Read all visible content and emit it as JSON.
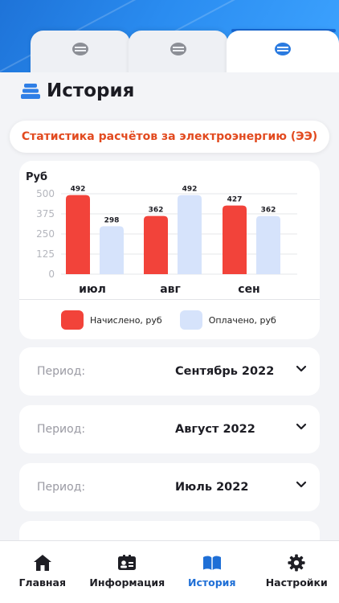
{
  "header": {
    "tabs": [
      {
        "icon": "company-logo-icon",
        "active": false
      },
      {
        "icon": "company-logo-icon",
        "active": false
      },
      {
        "icon": "company-logo-icon",
        "active": true
      }
    ]
  },
  "page": {
    "title": "История",
    "stat_button": "Статистика расчётов за электроэнергию (ЭЭ)"
  },
  "chart_data": {
    "type": "bar",
    "ylabel": "Руб",
    "categories": [
      "июл",
      "авг",
      "сен"
    ],
    "series": [
      {
        "name": "Начислено, руб",
        "values": [
          492,
          362,
          427
        ],
        "color": "#f2433a"
      },
      {
        "name": "Оплачено, руб",
        "values": [
          298,
          492,
          362
        ],
        "color": "#d6e3fb"
      }
    ],
    "yticks": [
      0,
      125,
      250,
      375,
      500
    ],
    "ylim": [
      0,
      500
    ],
    "grid": true,
    "legend": "bottom"
  },
  "periods": [
    {
      "label": "Период:",
      "value": "Сентябрь 2022"
    },
    {
      "label": "Период:",
      "value": "Август 2022"
    },
    {
      "label": "Период:",
      "value": "Июль 2022"
    },
    {
      "label": "",
      "value": ""
    }
  ],
  "nav": [
    {
      "label": "Главная",
      "icon": "home-icon",
      "active": false
    },
    {
      "label": "Информация",
      "icon": "id-card-icon",
      "active": false
    },
    {
      "label": "История",
      "icon": "book-icon",
      "active": true
    },
    {
      "label": "Настройки",
      "icon": "gear-icon",
      "active": false
    }
  ],
  "colors": {
    "accent": "#1f6fd6",
    "charged": "#f2433a",
    "paid": "#d6e3fb",
    "stat_text": "#e24a1f"
  }
}
